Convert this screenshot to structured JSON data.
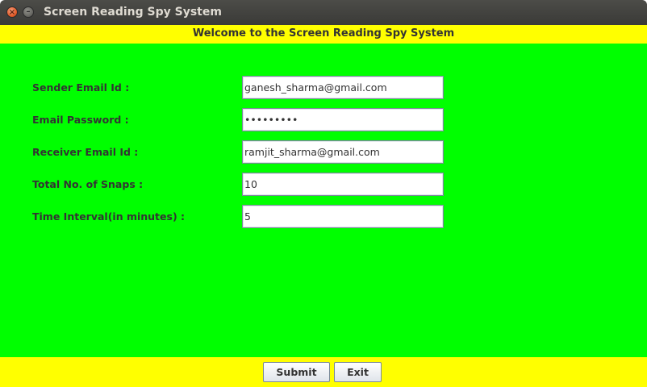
{
  "window": {
    "title": "Screen Reading Spy System",
    "close_glyph": "×",
    "minimize_glyph": "–",
    "close_icon": "close-icon",
    "minimize_icon": "minimize-icon"
  },
  "banner": {
    "text": "Welcome to the Screen Reading Spy System"
  },
  "form": {
    "sender_email": {
      "label": "Sender Email Id :",
      "value": "ganesh_sharma@gmail.com"
    },
    "email_password": {
      "label": "Email Password :",
      "value": "•••••••••"
    },
    "receiver_email": {
      "label": "Receiver Email Id :",
      "value": "ramjit_sharma@gmail.com"
    },
    "total_snaps": {
      "label": "Total No. of Snaps :",
      "value": "10"
    },
    "time_interval": {
      "label": "Time Interval(in minutes) :",
      "value": "5"
    }
  },
  "buttons": {
    "submit": "Submit",
    "exit": "Exit"
  },
  "colors": {
    "banner_bg": "#ffff00",
    "main_bg": "#00ff00",
    "footer_bg": "#ffff00",
    "titlebar_bg": "#3c3b37"
  }
}
